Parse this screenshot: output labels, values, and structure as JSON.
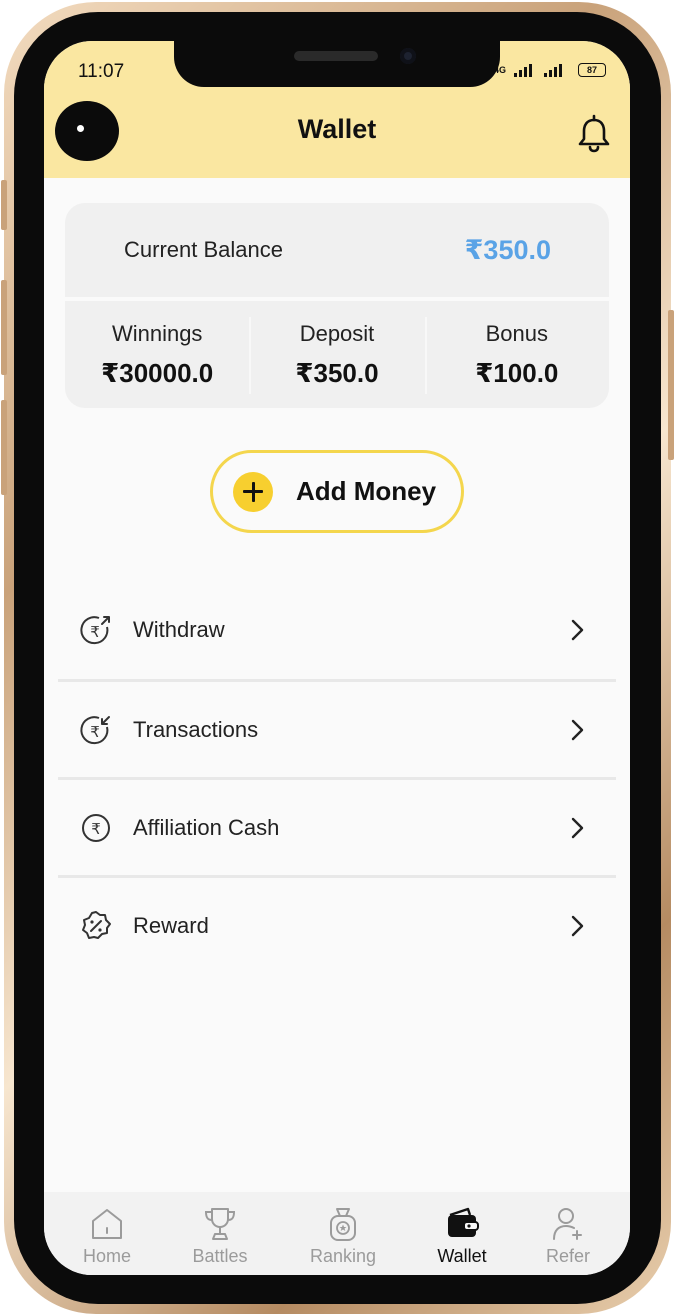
{
  "status_bar": {
    "time": "11:07",
    "network": "4G",
    "battery": "87"
  },
  "header": {
    "title": "Wallet",
    "background": "#fae7a1"
  },
  "balance_card": {
    "current_balance_label": "Current Balance",
    "current_balance_value": "₹350.0",
    "accent": "#5aa3e6",
    "stats": [
      {
        "label": "Winnings",
        "value": "₹30000.0"
      },
      {
        "label": "Deposit",
        "value": "₹350.0"
      },
      {
        "label": "Bonus",
        "value": "₹100.0"
      }
    ]
  },
  "add_money": {
    "label": "Add Money",
    "accent": "#f7cf2f"
  },
  "menu": [
    {
      "label": "Withdraw",
      "icon": "withdraw-icon"
    },
    {
      "label": "Transactions",
      "icon": "transactions-icon"
    },
    {
      "label": "Affiliation Cash",
      "icon": "rupee-icon"
    },
    {
      "label": "Reward",
      "icon": "reward-badge-icon"
    }
  ],
  "bottom_nav": [
    {
      "label": "Home",
      "icon": "home-icon",
      "active": false
    },
    {
      "label": "Battles",
      "icon": "trophy-icon",
      "active": false
    },
    {
      "label": "Ranking",
      "icon": "ranking-icon",
      "active": false
    },
    {
      "label": "Wallet",
      "icon": "wallet-icon",
      "active": true
    },
    {
      "label": "Refer",
      "icon": "refer-icon",
      "active": false
    }
  ]
}
